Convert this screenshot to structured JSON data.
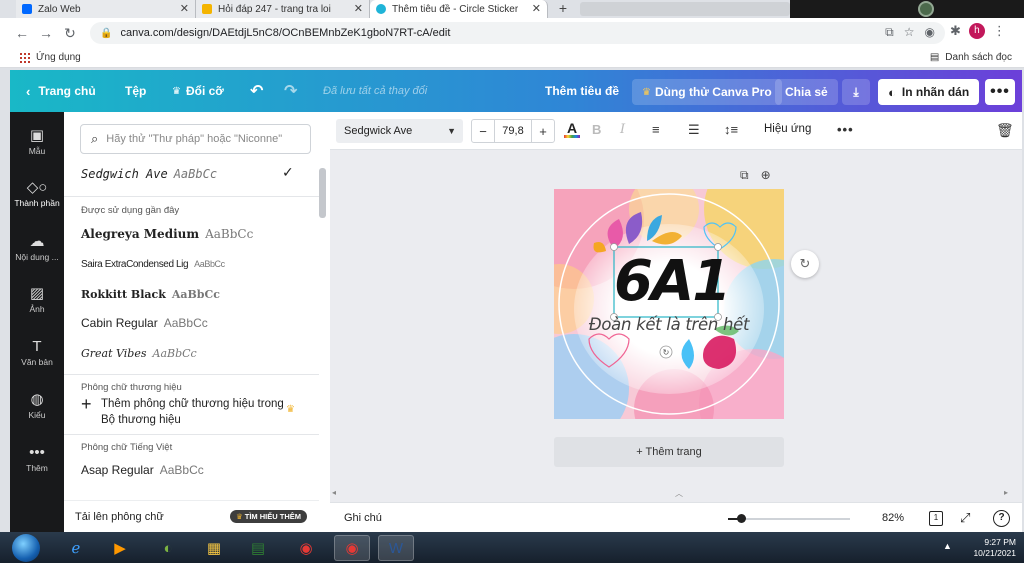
{
  "browser": {
    "tabs": [
      {
        "label": "Zalo Web",
        "favicon_color": "#0068ff"
      },
      {
        "label": "Hỏi đáp 247 - trang tra loi",
        "favicon_color": "#f4b400"
      },
      {
        "label": "Thêm tiêu đề - Circle Sticker",
        "favicon_color": "#1fb4d8"
      }
    ],
    "url": "canva.com/design/DAEtdjL5nC8/OCnBEMnbZeK1gboN7RT-cA/edit",
    "profile_initial": "h",
    "bookmarks": {
      "apps_label": "Ứng dụng",
      "reading_list_label": "Danh sách đọc"
    }
  },
  "canva_header": {
    "home": "Trang chủ",
    "file": "Tệp",
    "resize": "Đổi cỡ",
    "saved_status": "Đã lưu tất cả thay đổi",
    "design_title": "Thêm tiêu đề",
    "try_pro": "Dùng thử Canva Pro",
    "share": "Chia sẻ",
    "print": "In nhãn dán",
    "accent_start": "#19b8c7",
    "accent_end": "#6c3fd9"
  },
  "rail": [
    {
      "label": "Mẫu",
      "icon": "template-icon"
    },
    {
      "label": "Thành phần",
      "icon": "elements-icon"
    },
    {
      "label": "Nội dung ...",
      "icon": "upload-cloud-icon"
    },
    {
      "label": "Ảnh",
      "icon": "photo-icon"
    },
    {
      "label": "Văn bản",
      "icon": "text-icon"
    },
    {
      "label": "Kiểu",
      "icon": "palette-icon"
    },
    {
      "label": "Thêm",
      "icon": "more-icon"
    }
  ],
  "font_panel": {
    "search_placeholder": "Hãy thử \"Thư pháp\" hoặc \"Niconne\"",
    "current_font": {
      "name": "Sedgwich Ave",
      "sample": "AaBbCc"
    },
    "recent_label": "Được sử dụng gần đây",
    "recent_fonts": [
      {
        "name": "Alegreya Medium",
        "sample": "AaBbCc"
      },
      {
        "name": "Saira ExtraCondensed Lig",
        "sample": "AaBbCc"
      },
      {
        "name": "Rokkitt Black",
        "sample": "AaBbCc"
      },
      {
        "name": "Cabin Regular",
        "sample": "AaBbCc"
      },
      {
        "name": "Great Vibes",
        "sample": "AaBbCc"
      }
    ],
    "brand_label": "Phông chữ thương hiệu",
    "brand_add": "Thêm phông chữ thương hiệu trong Bộ thương hiệu",
    "vn_label": "Phông chữ Tiếng Việt",
    "vn_fonts": [
      {
        "name": "Asap Regular",
        "sample": "AaBbCc"
      }
    ],
    "upload_label": "Tải lên phông chữ",
    "learn_more": "TÌM HIỂU THÊM"
  },
  "toolbar": {
    "font_name": "Sedgwick Ave",
    "font_size": "79,8",
    "effects": "Hiệu ứng"
  },
  "design": {
    "title": "6A1",
    "slogan": "Đoàn kết là trên hết"
  },
  "canvas": {
    "add_page": "+ Thêm trang"
  },
  "bottombar": {
    "notes": "Ghi chú",
    "zoom_percent": 82,
    "zoom_label": "82%",
    "page_count": "1"
  },
  "taskbar": {
    "time": "9:27 PM",
    "date": "10/21/2021"
  }
}
